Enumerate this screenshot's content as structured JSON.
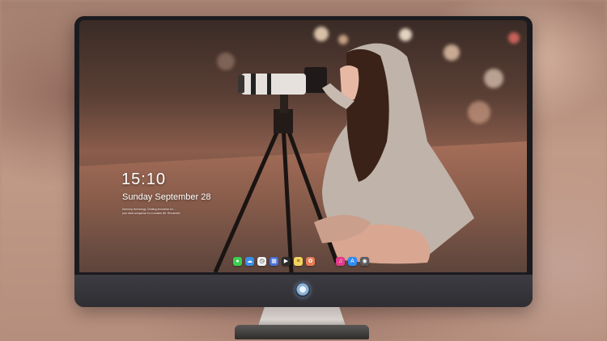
{
  "lock_screen": {
    "time": "15:10",
    "date": "Sunday September 28",
    "blurb_line1": "Harmony technology. Creating innovation for…",
    "blurb_line2": "your ideal companion for a smarter life. Remember"
  },
  "dock": {
    "apps": [
      {
        "name": "messages-icon",
        "color": "#3ccf4e",
        "glyph": "●"
      },
      {
        "name": "weather-icon",
        "color": "#3a8ee6",
        "glyph": "☁"
      },
      {
        "name": "clock-app-icon",
        "color": "#f2f2f2",
        "glyph": "◷"
      },
      {
        "name": "calendar-icon",
        "color": "#4a6fd6",
        "glyph": "▦"
      },
      {
        "name": "clapper-icon",
        "color": "#2a2a2a",
        "glyph": "▶"
      },
      {
        "name": "notes-icon",
        "color": "#f4d35e",
        "glyph": "≡"
      },
      {
        "name": "photos-icon",
        "color": "#e87c55",
        "glyph": "✿"
      },
      {
        "name": "music-icon",
        "color": "#e23a8a",
        "glyph": "♫"
      },
      {
        "name": "app-store-icon",
        "color": "#2d8cf0",
        "glyph": "A"
      },
      {
        "name": "camera-icon",
        "color": "#5a5a5e",
        "glyph": "◉"
      }
    ]
  },
  "colors": {
    "bezel": "#1b1b1f",
    "chin": "#35343a",
    "wallpaper_tone": "#8a5d4c"
  }
}
